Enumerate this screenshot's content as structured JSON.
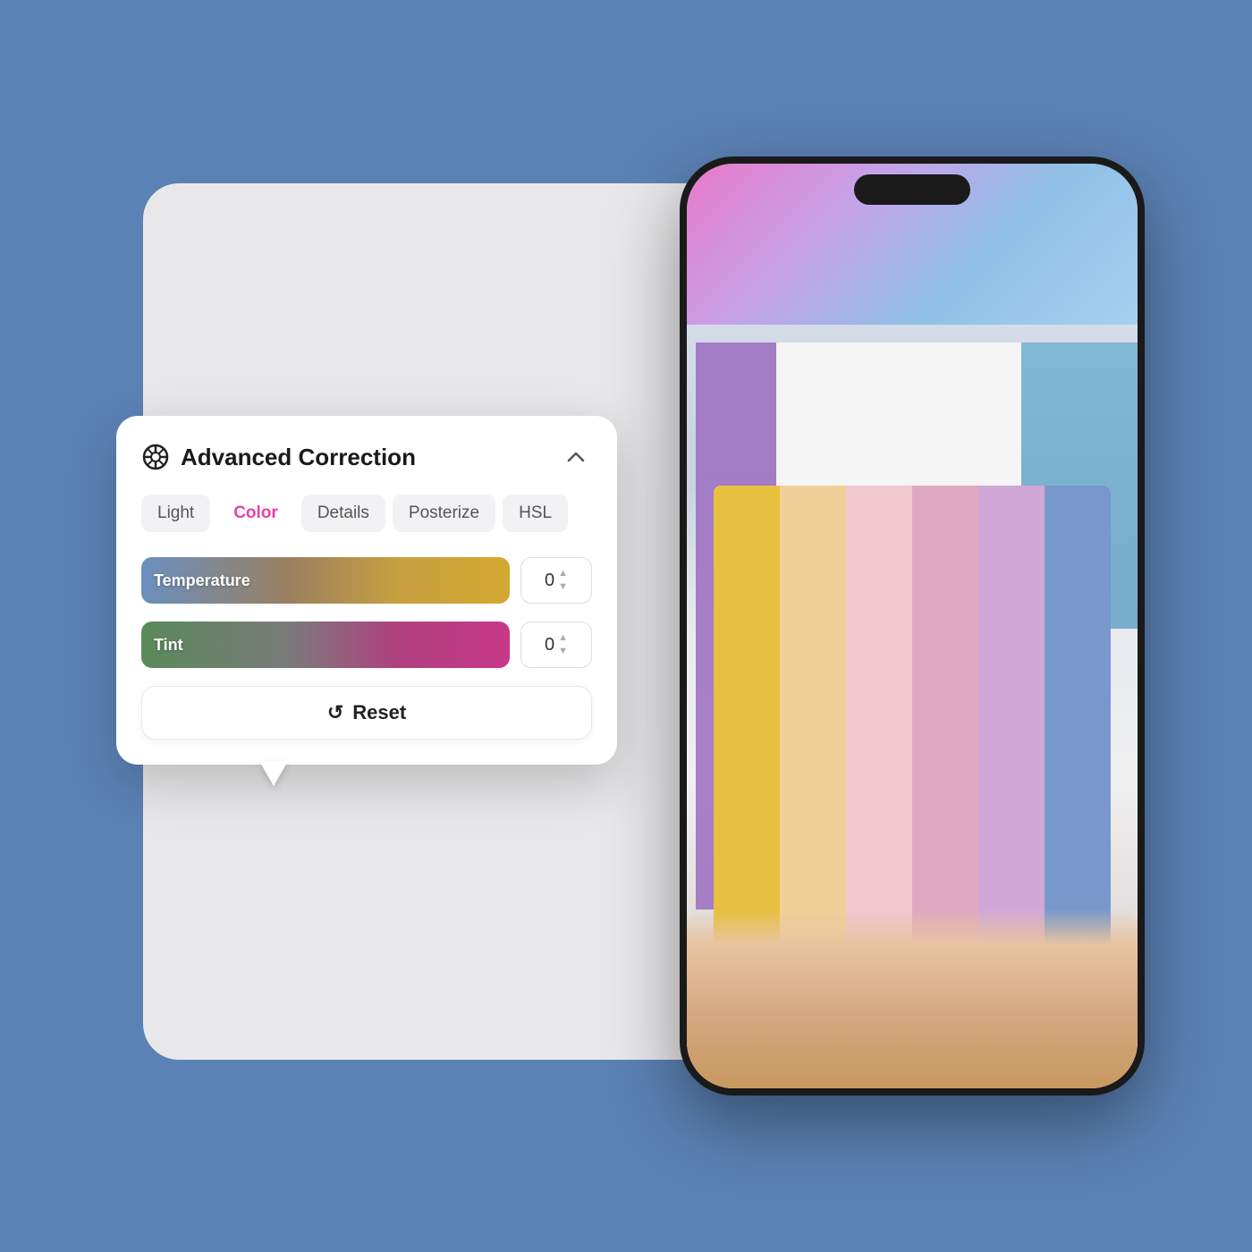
{
  "background_color": "#5b82b5",
  "panel": {
    "title": "Advanced Correction",
    "icon_name": "advanced-correction-icon",
    "collapse_icon": "chevron-up-icon",
    "tabs": [
      {
        "id": "light",
        "label": "Light",
        "active": false
      },
      {
        "id": "color",
        "label": "Color",
        "active": true
      },
      {
        "id": "details",
        "label": "Details",
        "active": false
      },
      {
        "id": "posterize",
        "label": "Posterize",
        "active": false
      },
      {
        "id": "hsl",
        "label": "HSL",
        "active": false
      }
    ],
    "sliders": [
      {
        "id": "temperature",
        "label": "Temperature",
        "value": 0,
        "gradient": "temperature"
      },
      {
        "id": "tint",
        "label": "Tint",
        "value": 0,
        "gradient": "tint"
      }
    ],
    "reset_button_label": "Reset",
    "reset_icon_name": "reset-icon"
  },
  "phone": {
    "paint_stripes": [
      {
        "color": "#f0c040"
      },
      {
        "color": "#f0d090"
      },
      {
        "color": "#e8b8c0"
      },
      {
        "color": "#d8a0c0"
      },
      {
        "color": "#c0a0d8"
      },
      {
        "color": "#7090c8"
      }
    ]
  }
}
